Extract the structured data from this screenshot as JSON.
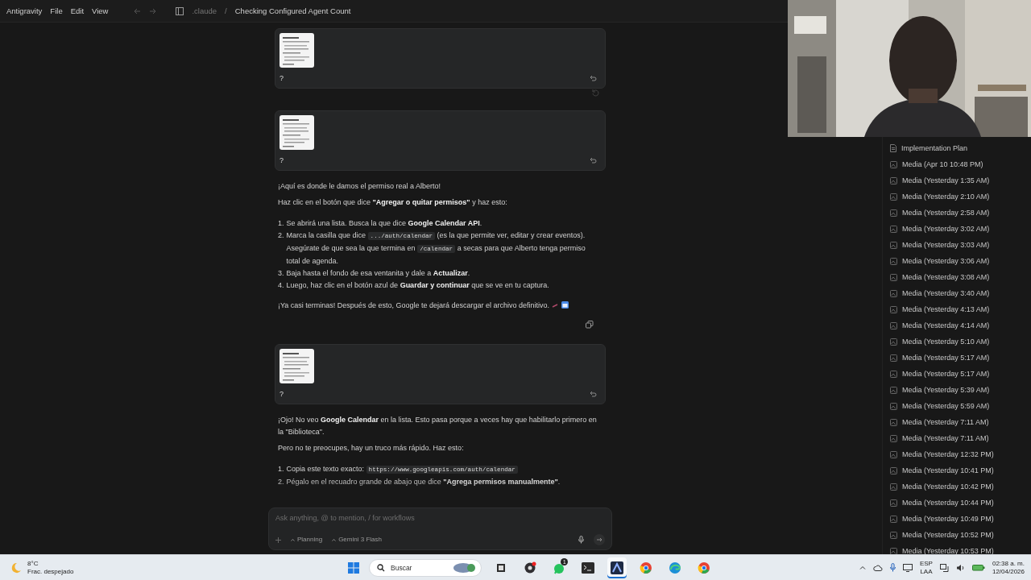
{
  "menu_bar": {
    "app_name": "Antigravity",
    "menus": [
      "File",
      "Edit",
      "View"
    ],
    "breadcrumb": [
      ".claude",
      "/",
      "Checking Configured Agent Count"
    ]
  },
  "chat": {
    "messages": [
      {
        "kind": "image_prompt",
        "text": "?"
      },
      {
        "kind": "marker"
      },
      {
        "kind": "image_prompt",
        "text": "?"
      },
      {
        "kind": "reply",
        "copy_button": true,
        "blocks": [
          {
            "kind": "p",
            "segments": [
              {
                "kind": "text",
                "text": "¡Aquí es donde le damos el permiso real a Alberto!"
              }
            ]
          },
          {
            "kind": "p",
            "segments": [
              {
                "kind": "text",
                "text": "Haz clic en el botón que dice **\"Agregar o quitar permisos\"** y haz esto:"
              }
            ]
          },
          {
            "kind": "ol",
            "items": [
              {
                "number": "1.",
                "segments": [
                  {
                    "kind": "text",
                    "text": "Se abrirá una lista. Busca la que dice **Google Calendar API**."
                  }
                ]
              },
              {
                "number": "2.",
                "segments": [
                  {
                    "kind": "text",
                    "text": "Marca la casilla que dice "
                  },
                  {
                    "kind": "code",
                    "text": ".../auth/calendar"
                  },
                  {
                    "kind": "text",
                    "text": " (es la que permite ver, editar y crear eventos). Asegúrate de que sea la que termina en "
                  },
                  {
                    "kind": "code",
                    "text": "/calendar"
                  },
                  {
                    "kind": "text",
                    "text": " a secas para que Alberto tenga permiso total de agenda."
                  }
                ]
              },
              {
                "number": "3.",
                "segments": [
                  {
                    "kind": "text",
                    "text": "Baja hasta el fondo de esa ventanita y dale a **Actualizar**."
                  }
                ]
              },
              {
                "number": "4.",
                "segments": [
                  {
                    "kind": "text",
                    "text": "Luego, haz clic en el botón azul de **Guardar y continuar** que se ve en tu captura."
                  }
                ]
              }
            ]
          },
          {
            "kind": "p",
            "segments": [
              {
                "kind": "text",
                "text": "¡Ya casi terminas! Después de esto, Google te dejará descargar el archivo definitivo."
              },
              {
                "kind": "calendar_emoji"
              }
            ]
          }
        ]
      },
      {
        "kind": "image_prompt",
        "text": "?"
      },
      {
        "kind": "reply",
        "copy_button": false,
        "blocks": [
          {
            "kind": "p",
            "segments": [
              {
                "kind": "text",
                "text": "¡Ojo! No veo **Google Calendar** en la lista. Esto pasa porque a veces hay que habilitarlo primero en la \"Biblioteca\"."
              }
            ]
          },
          {
            "kind": "p",
            "segments": [
              {
                "kind": "text",
                "text": "Pero no te preocupes, hay un truco más rápido. Haz esto:"
              }
            ]
          },
          {
            "kind": "ol",
            "items": [
              {
                "number": "1.",
                "segments": [
                  {
                    "kind": "text",
                    "text": "Copia este texto exacto: "
                  },
                  {
                    "kind": "code",
                    "text": "https://www.googleapis.com/auth/calendar"
                  }
                ]
              },
              {
                "number": "2.",
                "segments": [
                  {
                    "kind": "text",
                    "text": "Pégalo en el recuadro grande de abajo que dice **\"Agrega permisos manualmente\"**."
                  }
                ]
              }
            ]
          }
        ]
      }
    ]
  },
  "composer": {
    "placeholder": "Ask anything, @ to mention, / for workflows",
    "mode": "Planning",
    "model": "Gemini 3 Flash"
  },
  "artifacts": {
    "items": [
      {
        "kind": "document",
        "label": "Implementation Plan"
      },
      {
        "kind": "media",
        "label": "Media (Apr 10 10:48 PM)"
      },
      {
        "kind": "media",
        "label": "Media (Yesterday 1:35 AM)"
      },
      {
        "kind": "media",
        "label": "Media (Yesterday 2:10 AM)"
      },
      {
        "kind": "media",
        "label": "Media (Yesterday 2:58 AM)"
      },
      {
        "kind": "media",
        "label": "Media (Yesterday 3:02 AM)"
      },
      {
        "kind": "media",
        "label": "Media (Yesterday 3:03 AM)"
      },
      {
        "kind": "media",
        "label": "Media (Yesterday 3:06 AM)"
      },
      {
        "kind": "media",
        "label": "Media (Yesterday 3:08 AM)"
      },
      {
        "kind": "media",
        "label": "Media (Yesterday 3:40 AM)"
      },
      {
        "kind": "media",
        "label": "Media (Yesterday 4:13 AM)"
      },
      {
        "kind": "media",
        "label": "Media (Yesterday 4:14 AM)"
      },
      {
        "kind": "media",
        "label": "Media (Yesterday 5:10 AM)"
      },
      {
        "kind": "media",
        "label": "Media (Yesterday 5:17 AM)"
      },
      {
        "kind": "media",
        "label": "Media (Yesterday 5:17 AM)"
      },
      {
        "kind": "media",
        "label": "Media (Yesterday 5:39 AM)"
      },
      {
        "kind": "media",
        "label": "Media (Yesterday 5:59 AM)"
      },
      {
        "kind": "media",
        "label": "Media (Yesterday 7:11 AM)"
      },
      {
        "kind": "media",
        "label": "Media (Yesterday 7:11 AM)"
      },
      {
        "kind": "media",
        "label": "Media (Yesterday 12:32 PM)"
      },
      {
        "kind": "media",
        "label": "Media (Yesterday 10:41 PM)"
      },
      {
        "kind": "media",
        "label": "Media (Yesterday 10:42 PM)"
      },
      {
        "kind": "media",
        "label": "Media (Yesterday 10:44 PM)"
      },
      {
        "kind": "media",
        "label": "Media (Yesterday 10:49 PM)"
      },
      {
        "kind": "media",
        "label": "Media (Yesterday 10:52 PM)"
      },
      {
        "kind": "media",
        "label": "Media (Yesterday 10:53 PM)"
      }
    ]
  },
  "taskbar": {
    "weather": {
      "temperature": "8°C",
      "condition": "Frac. despejado"
    },
    "search_placeholder": "Buscar",
    "apps": [
      {
        "kind": "explorer",
        "active": false
      },
      {
        "kind": "recorder",
        "active": false
      },
      {
        "kind": "chat",
        "badge": "1",
        "active": false
      },
      {
        "kind": "terminal",
        "active": false
      },
      {
        "kind": "antigravity",
        "active": true
      },
      {
        "kind": "chrome",
        "active": false
      },
      {
        "kind": "edge",
        "active": false
      },
      {
        "kind": "chrome",
        "active": false
      }
    ],
    "language": [
      "ESP",
      "LAA"
    ],
    "time": "02:38 a. m.",
    "date": "12/04/2026"
  }
}
